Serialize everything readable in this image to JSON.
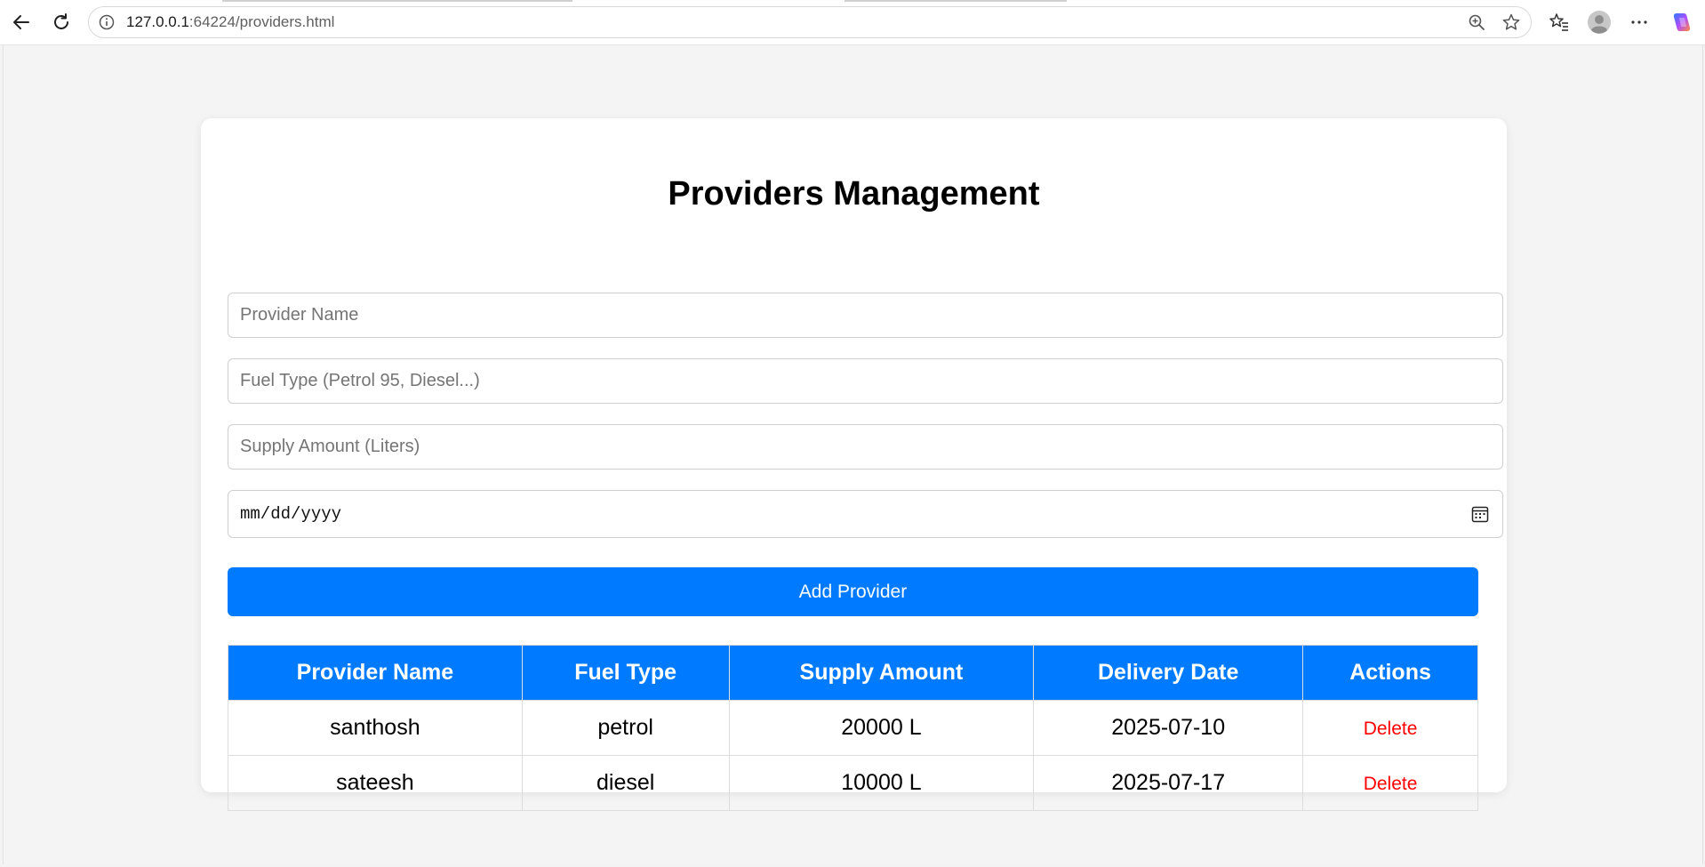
{
  "browser": {
    "url_host": "127.0.0.1",
    "url_rest": ":64224/providers.html"
  },
  "page": {
    "title": "Providers Management"
  },
  "form": {
    "provider_name_placeholder": "Provider Name",
    "fuel_type_placeholder": "Fuel Type (Petrol 95, Diesel...)",
    "supply_amount_placeholder": "Supply Amount (Liters)",
    "date_placeholder": "mm/dd/yyyy",
    "add_button_label": "Add Provider"
  },
  "table": {
    "headers": [
      "Provider Name",
      "Fuel Type",
      "Supply Amount",
      "Delivery Date",
      "Actions"
    ],
    "rows": [
      {
        "name": "santhosh",
        "fuel": "petrol",
        "amount": "20000 L",
        "date": "2025-07-10",
        "action": "Delete"
      },
      {
        "name": "sateesh",
        "fuel": "diesel",
        "amount": "10000 L",
        "date": "2025-07-17",
        "action": "Delete"
      }
    ]
  },
  "colors": {
    "accent": "#007bff",
    "delete": "#ff0000",
    "page_bg": "#f4f4f4"
  }
}
